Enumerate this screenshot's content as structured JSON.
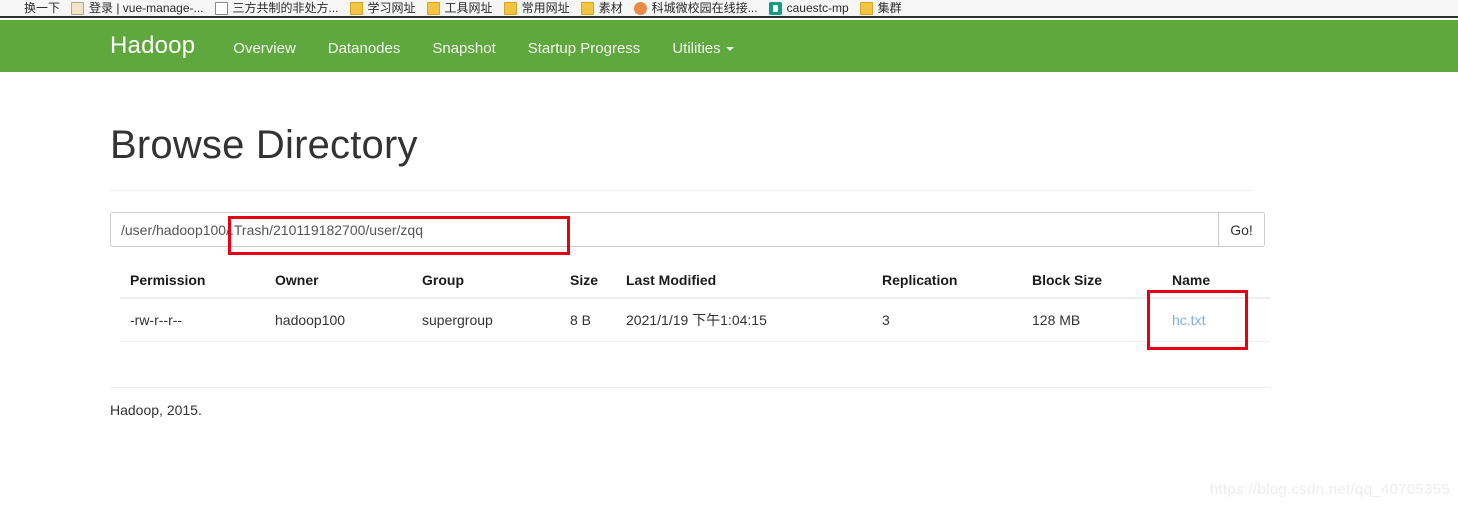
{
  "browser": {
    "bookmarks": [
      {
        "label": "换一下",
        "icon": "blank-icon"
      },
      {
        "label": "登录 | vue-manage-...",
        "icon": "mountain-icon"
      },
      {
        "label": "三方共制的非处方...",
        "icon": "page-icon"
      },
      {
        "label": "学习网址",
        "icon": "folder-icon"
      },
      {
        "label": "工具网址",
        "icon": "folder-icon"
      },
      {
        "label": "常用网址",
        "icon": "folder-icon"
      },
      {
        "label": "素材",
        "icon": "folder-icon"
      },
      {
        "label": "科城微校园在线接...",
        "icon": "orange-circle-icon"
      },
      {
        "label": "cauestc-mp",
        "icon": "teal-app-icon"
      },
      {
        "label": "集群",
        "icon": "folder-icon"
      }
    ]
  },
  "navbar": {
    "brand": "Hadoop",
    "links": [
      {
        "label": "Overview",
        "caret": false
      },
      {
        "label": "Datanodes",
        "caret": false
      },
      {
        "label": "Snapshot",
        "caret": false
      },
      {
        "label": "Startup Progress",
        "caret": false
      },
      {
        "label": "Utilities",
        "caret": true
      }
    ],
    "background_color": "#5fa83d"
  },
  "page": {
    "title": "Browse Directory"
  },
  "path_bar": {
    "value": "/user/hadoop100/.Trash/210119182700/user/zqq",
    "placeholder": "",
    "go_label": "Go!"
  },
  "table": {
    "headers": [
      "Permission",
      "Owner",
      "Group",
      "Size",
      "Last Modified",
      "Replication",
      "Block Size",
      "Name"
    ],
    "rows": [
      {
        "permission": "-rw-r--r--",
        "owner": "hadoop100",
        "group": "supergroup",
        "size": "8 B",
        "last_modified": "2021/1/19 下午1:04:15",
        "replication": "3",
        "block_size": "128 MB",
        "name": "hc.txt"
      }
    ]
  },
  "footer": {
    "text": "Hadoop, 2015."
  },
  "annotations": {
    "color": "#e60012",
    "boxes": [
      {
        "target": "path-input-trash-segment"
      },
      {
        "target": "name-column-file-link"
      }
    ]
  },
  "watermark": {
    "text": "https://blog.csdn.net/qq_40705355"
  }
}
